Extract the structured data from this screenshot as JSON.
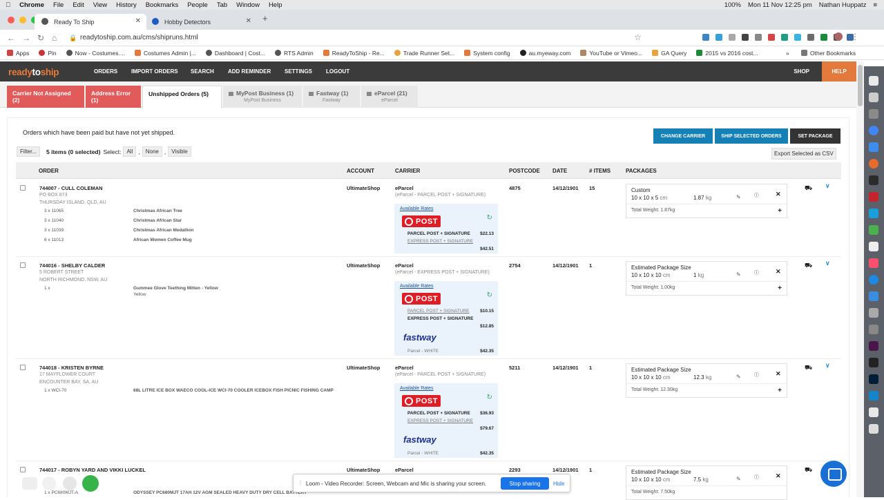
{
  "mac_menu": {
    "app": "Chrome",
    "items": [
      "File",
      "Edit",
      "View",
      "History",
      "Bookmarks",
      "People",
      "Tab",
      "Window",
      "Help"
    ],
    "battery": "100%",
    "datetime": "Mon 11 Nov  12:25 pm",
    "user": "Nathan Huppatz"
  },
  "browser": {
    "tabs": [
      {
        "title": "Ready To Ship",
        "active": true
      },
      {
        "title": "Hobby Detectors",
        "active": false
      }
    ],
    "url": "readytoship.com.au/cms/shipruns.html",
    "bookmarks": [
      "Apps",
      "Pin",
      "Now - Costumes....",
      "Costumes Admin |...",
      "Dashboard | Cost...",
      "RTS Admin",
      "ReadyToShip - Re...",
      "Trade Runner Set...",
      "System config",
      "au.myeway.com",
      "YouTube or Vimeo...",
      "GA Query",
      "2015 vs 2016 cost..."
    ],
    "other_bookmarks": "Other Bookmarks"
  },
  "nav": {
    "logo": {
      "a": "ready",
      "b": "to",
      "c": "ship"
    },
    "items": [
      "ORDERS",
      "IMPORT ORDERS",
      "SEARCH",
      "ADD REMINDER",
      "SETTINGS",
      "LOGOUT"
    ],
    "shop": "SHOP",
    "help": "HELP"
  },
  "subtabs": [
    {
      "label": "Carrier Not Assigned (2)",
      "sub": ""
    },
    {
      "label": "Address Error (1)",
      "sub": ""
    },
    {
      "label": "Unshipped Orders (5)",
      "sub": ""
    },
    {
      "label": "MyPost Business (1)",
      "sub": "MyPost Business"
    },
    {
      "label": "Fastway (1)",
      "sub": "Fastway"
    },
    {
      "label": "eParcel (21)",
      "sub": "eParcel"
    }
  ],
  "page": {
    "description": "Orders which have been paid but have not yet shipped.",
    "change_carrier": "CHANGE CARRIER",
    "ship_selected": "SHIP SELECTED ORDERS",
    "set_package": "SET PACKAGE",
    "filter": "Filter...",
    "items_count": "5 items (0 selected)",
    "select_label": "Select:",
    "select_all": "All",
    "select_none": "None",
    "select_visible": "Visible",
    "export": "Export Selected as CSV"
  },
  "table": {
    "headers": [
      "ORDER",
      "ACCOUNT",
      "CARRIER",
      "POSTCODE",
      "DATE",
      "# ITEMS",
      "PACKAGES"
    ],
    "rates_title": "Available Rates",
    "rows": [
      {
        "order": "744007 - CULL COLEMAN",
        "addr1": "PO BOX 873",
        "addr2": "THURSDAY ISLAND, QLD, AU",
        "lines": [
          {
            "qty": "3 x 11065",
            "name": "Christmas African Tree"
          },
          {
            "qty": "3 x 11040",
            "name": "Christmas African Star"
          },
          {
            "qty": "3 x 11039",
            "name": "Christmas African Medallion"
          },
          {
            "qty": "6 x 11013",
            "name": "African Women Coffee Mug"
          }
        ],
        "account": "UltimateShop",
        "carrier": "eParcel",
        "carrier_sub": "(eParcel - PARCEL POST + SIGNATURE)",
        "rates": [
          {
            "label": "PARCEL POST + SIGNATURE",
            "price": "$22.13"
          },
          {
            "label": "EXPRESS POST + SIGNATURE",
            "price": "$42.51"
          }
        ],
        "postcode": "4875",
        "date": "14/12/1901",
        "items": "15",
        "pkg_name": "Custom",
        "pkg_dims": "10 x 10 x 5",
        "pkg_weight": "1.87",
        "pkg_total": "Total Weight: 1.87kg"
      },
      {
        "order": "744016 - SHELBY CALDER",
        "addr1": "5 ROBERT STREET",
        "addr2": "NORTH RICHMOND, NSW, AU",
        "lines": [
          {
            "qty": "1 x",
            "name": "Gummee Glove Teething Mitten - Yellow"
          }
        ],
        "line_extra": "Yellow",
        "account": "UltimateShop",
        "carrier": "eParcel",
        "carrier_sub": "(eParcel - EXPRESS POST + SIGNATURE)",
        "rates": [
          {
            "label": "PARCEL POST + SIGNATURE",
            "price": "$10.15"
          },
          {
            "label": "EXPRESS POST + SIGNATURE",
            "price": "$12.85"
          }
        ],
        "fastway": {
          "label": "Parcel - WHITE",
          "price": "$42.35"
        },
        "postcode": "2754",
        "date": "14/12/1901",
        "items": "1",
        "pkg_name": "Estimated Package Size",
        "pkg_dims": "10 x 10 x 10",
        "pkg_weight": "1",
        "pkg_total": "Total Weight: 1.00kg"
      },
      {
        "order": "744018 - KRISTEN BYRNE",
        "addr1": "17 MAYFLOWER COURT",
        "addr2": "ENCOUNTER BAY, SA, AU",
        "lines": [
          {
            "qty": "1 x WCI-70",
            "name": "68L LITRE ICE BOX WAECO COOL-ICE WCI-70 COOLER ICEBOX FISH PICNIC FISHING CAMP"
          }
        ],
        "account": "UltimateShop",
        "carrier": "eParcel",
        "carrier_sub": "(eParcel - PARCEL POST + SIGNATURE)",
        "rates": [
          {
            "label": "PARCEL POST + SIGNATURE",
            "price": "$36.93"
          },
          {
            "label": "EXPRESS POST + SIGNATURE",
            "price": "$79.67"
          }
        ],
        "fastway": {
          "label": "Parcel - WHITE",
          "price": "$42.35"
        },
        "postcode": "5211",
        "date": "14/12/1901",
        "items": "1",
        "pkg_name": "Estimated Package Size",
        "pkg_dims": "10 x 10 x 10",
        "pkg_weight": "12.3",
        "pkg_total": "Total Weight: 12.30kg"
      },
      {
        "order": "744017 - ROBYN YARD AND VIKKI LUCKEL",
        "lines": [
          {
            "qty": "1 x PC680MJT-A",
            "name": "ODYSSEY PC680MJT 17AH 12V AGM SEALED HEAVY DUTY DRY CELL BATTERY"
          }
        ],
        "account": "UltimateShop",
        "carrier": "eParcel",
        "postcode": "2293",
        "date": "14/12/1901",
        "items": "1",
        "pkg_name": "Estimated Package Size",
        "pkg_dims": "10 x 10 x 10",
        "pkg_weight": "7.5",
        "pkg_total": "Total Weight: 7.50kg"
      }
    ],
    "auspost_text": "POST",
    "fastway_text": "fastway",
    "unit_cm": "cm",
    "unit_kg": "kg"
  },
  "loom": {
    "message": "Loom - Video Recorder: Screen, Webcam and Mic is sharing your screen.",
    "stop": "Stop sharing",
    "hide": "Hide"
  }
}
